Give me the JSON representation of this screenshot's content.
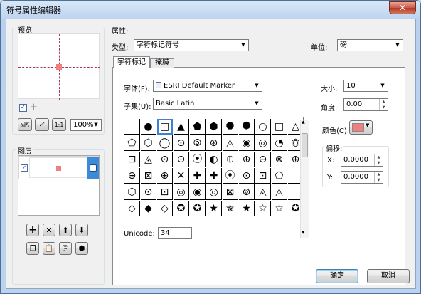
{
  "window": {
    "title": "符号属性编辑器",
    "close_glyph": "✕"
  },
  "preview": {
    "label": "预览",
    "zoom": "100%",
    "checkbox_checked": true
  },
  "layers": {
    "label": "图层"
  },
  "properties": {
    "label": "属性:",
    "type_label": "类型:",
    "type_value": "字符标记符号",
    "unit_label": "单位:",
    "unit_value": "磅"
  },
  "tabs": [
    {
      "label": "字符标记",
      "active": true
    },
    {
      "label": "掩膜",
      "active": false
    }
  ],
  "font": {
    "label": "字体(F):",
    "value": "ESRI Default Marker"
  },
  "subset": {
    "label": "子集(U):",
    "value": "Basic Latin"
  },
  "size": {
    "label": "大小:",
    "value": "10"
  },
  "angle": {
    "label": "角度:",
    "value": "0.00"
  },
  "color": {
    "label": "颜色(C):",
    "swatch": "#f08080"
  },
  "offset": {
    "label": "偏移:",
    "x_label": "X:",
    "x_value": "0.0000",
    "y_label": "Y:",
    "y_value": "0.0000"
  },
  "unicode": {
    "label": "Unicode:",
    "value": "34"
  },
  "buttons": {
    "ok": "确定",
    "cancel": "取消"
  },
  "symbol_rows": [
    [
      "",
      "●",
      "□",
      "▲",
      "⬟",
      "⬢",
      "⯃",
      "⯄",
      "○",
      "□",
      "△"
    ],
    [
      "⬠",
      "⬡",
      "◯",
      "⊙",
      "⦾",
      "⊛",
      "◬",
      "◉",
      "◎",
      "◔",
      "⏣"
    ],
    [
      "⊡",
      "◬",
      "⊙",
      "⊙",
      "⦿",
      "◐",
      "⦶",
      "⊕",
      "⊖",
      "⊗",
      "⊕"
    ],
    [
      "⊕",
      "⊠",
      "⊕",
      "✕",
      "✚",
      "✚",
      "⦿",
      "⊙",
      "⊡",
      "⬠",
      ""
    ],
    [
      "⬡",
      "⊙",
      "⊡",
      "◎",
      "◉",
      "◎",
      "⊠",
      "⊚",
      "◬",
      "◬",
      ""
    ],
    [
      "◇",
      "◆",
      "◇",
      "✪",
      "✪",
      "★",
      "✯",
      "★",
      "☆",
      "☆",
      "✪"
    ]
  ]
}
